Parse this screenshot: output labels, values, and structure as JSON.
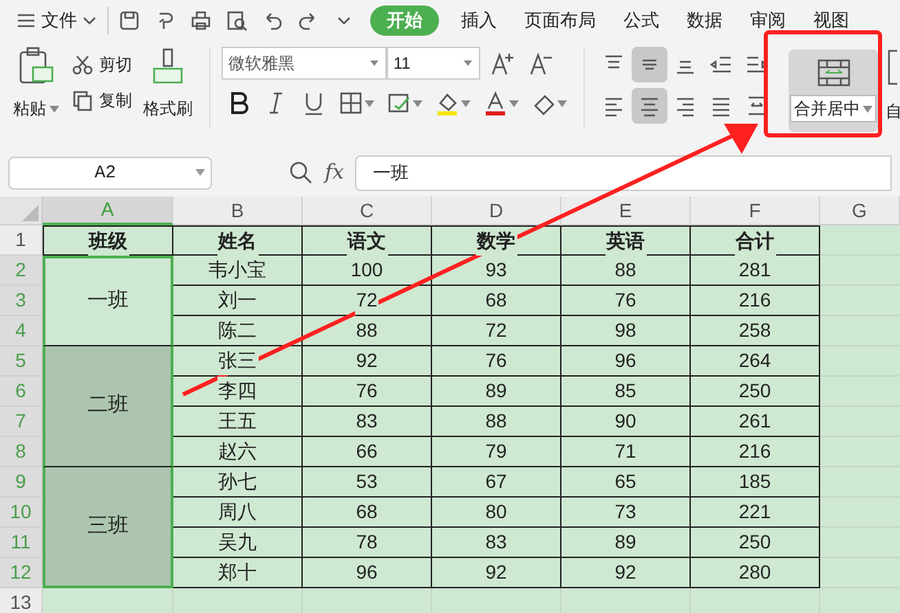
{
  "menu": {
    "file": "文件",
    "tabs": [
      {
        "label": "开始",
        "selected": true
      },
      {
        "label": "插入",
        "selected": false
      },
      {
        "label": "页面布局",
        "selected": false
      },
      {
        "label": "公式",
        "selected": false
      },
      {
        "label": "数据",
        "selected": false
      },
      {
        "label": "审阅",
        "selected": false
      },
      {
        "label": "视图",
        "selected": false
      }
    ]
  },
  "ribbon": {
    "paste": "粘贴",
    "cut": "剪切",
    "copy": "复制",
    "format_painter": "格式刷",
    "font_name": "微软雅黑",
    "font_size": "11",
    "align_buttons": [
      {
        "kind": "top",
        "selected": false
      },
      {
        "kind": "middle",
        "selected": true
      },
      {
        "kind": "bottom",
        "selected": false
      },
      {
        "kind": "outdent",
        "selected": false
      },
      {
        "kind": "indent",
        "selected": false
      },
      {
        "kind": "left",
        "selected": false
      },
      {
        "kind": "center",
        "selected": true
      },
      {
        "kind": "right",
        "selected": false
      },
      {
        "kind": "justify",
        "selected": false
      },
      {
        "kind": "distribute",
        "selected": false
      }
    ],
    "merge": "合并居中",
    "next": "自"
  },
  "formula_bar": {
    "cell_ref": "A2",
    "fx": "fx",
    "value": "一班"
  },
  "sheet": {
    "columns": [
      {
        "label": "A",
        "selected": true
      },
      {
        "label": "B",
        "selected": false
      },
      {
        "label": "C",
        "selected": false
      },
      {
        "label": "D",
        "selected": false
      },
      {
        "label": "E",
        "selected": false
      },
      {
        "label": "F",
        "selected": false
      },
      {
        "label": "G",
        "selected": false
      }
    ],
    "row_numbers": [
      {
        "label": "1",
        "selected": false
      },
      {
        "label": "2",
        "selected": true
      },
      {
        "label": "3",
        "selected": true
      },
      {
        "label": "4",
        "selected": true
      },
      {
        "label": "5",
        "selected": true
      },
      {
        "label": "6",
        "selected": true
      },
      {
        "label": "7",
        "selected": true
      },
      {
        "label": "8",
        "selected": true
      },
      {
        "label": "9",
        "selected": true
      },
      {
        "label": "10",
        "selected": true
      },
      {
        "label": "11",
        "selected": true
      },
      {
        "label": "12",
        "selected": true
      },
      {
        "label": "13",
        "selected": false
      }
    ],
    "header": [
      "班级",
      "姓名",
      "语文",
      "数学",
      "英语",
      "合计"
    ],
    "groups": [
      {
        "class": "一班",
        "active": true,
        "rows": [
          [
            "韦小宝",
            "100",
            "93",
            "88",
            "281"
          ],
          [
            "刘一",
            "72",
            "68",
            "76",
            "216"
          ],
          [
            "陈二",
            "88",
            "72",
            "98",
            "258"
          ]
        ]
      },
      {
        "class": "二班",
        "active": false,
        "rows": [
          [
            "张三",
            "92",
            "76",
            "96",
            "264"
          ],
          [
            "李四",
            "76",
            "89",
            "85",
            "250"
          ],
          [
            "王五",
            "83",
            "88",
            "90",
            "261"
          ],
          [
            "赵六",
            "66",
            "79",
            "71",
            "216"
          ]
        ]
      },
      {
        "class": "三班",
        "active": false,
        "rows": [
          [
            "孙七",
            "53",
            "67",
            "65",
            "185"
          ],
          [
            "周八",
            "68",
            "80",
            "73",
            "221"
          ],
          [
            "吴九",
            "78",
            "83",
            "89",
            "250"
          ],
          [
            "郑十",
            "96",
            "92",
            "92",
            "280"
          ]
        ]
      }
    ]
  }
}
